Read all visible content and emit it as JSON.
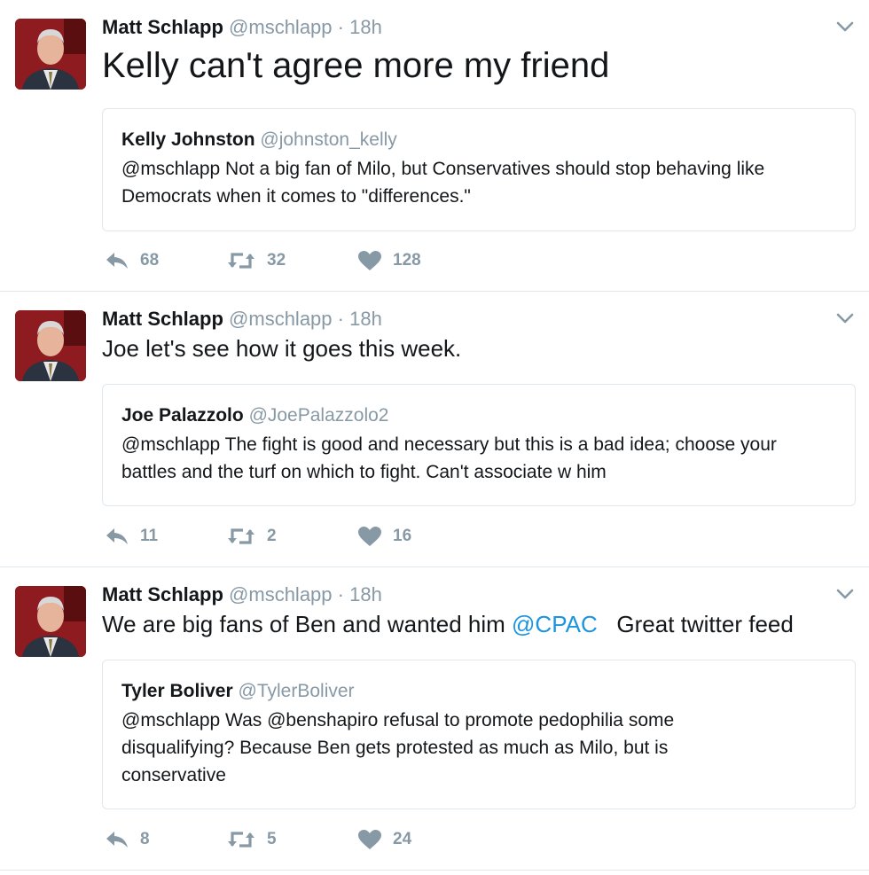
{
  "tweets": [
    {
      "author_name": "Matt Schlapp",
      "author_handle": "@mschlapp",
      "separator": "·",
      "time": "18h",
      "text_before": "Kelly can't agree more my friend",
      "mention": "",
      "text_after": "",
      "quote": {
        "name": "Kelly Johnston",
        "handle": "@johnston_kelly",
        "text": "@mschlapp Not a big fan of Milo, but Conservatives should stop behaving like Democrats when it comes to \"differences.\""
      },
      "replies": "68",
      "retweets": "32",
      "likes": "128"
    },
    {
      "author_name": "Matt Schlapp",
      "author_handle": "@mschlapp",
      "separator": "·",
      "time": "18h",
      "text_before": "Joe let's see how it goes this week.",
      "mention": "",
      "text_after": "",
      "quote": {
        "name": "Joe Palazzolo",
        "handle": "@JoePalazzolo2",
        "text": "@mschlapp The fight is good and necessary but this is a bad idea; choose your battles and the turf on which to fight.  Can't associate w him"
      },
      "replies": "11",
      "retweets": "2",
      "likes": "16"
    },
    {
      "author_name": "Matt Schlapp",
      "author_handle": "@mschlapp",
      "separator": "·",
      "time": "18h",
      "text_before": "We are big fans of Ben and wanted him ",
      "mention": "@CPAC",
      "text_after": "   Great twitter feed",
      "quote": {
        "name": "Tyler Boliver",
        "handle": "@TylerBoliver",
        "text": "@mschlapp Was @benshapiro refusal to promote pedophilia some disqualifying? Because Ben gets protested as much as Milo, but is conservative"
      },
      "replies": "8",
      "retweets": "5",
      "likes": "24"
    }
  ],
  "colors": {
    "link": "#1b95e0",
    "muted": "#8899a6",
    "border": "#e1e8ed"
  },
  "icons": {
    "avatar": "avatar-photo",
    "reply": "reply-icon",
    "retweet": "retweet-icon",
    "like": "heart-icon",
    "caret": "chevron-down-icon"
  }
}
